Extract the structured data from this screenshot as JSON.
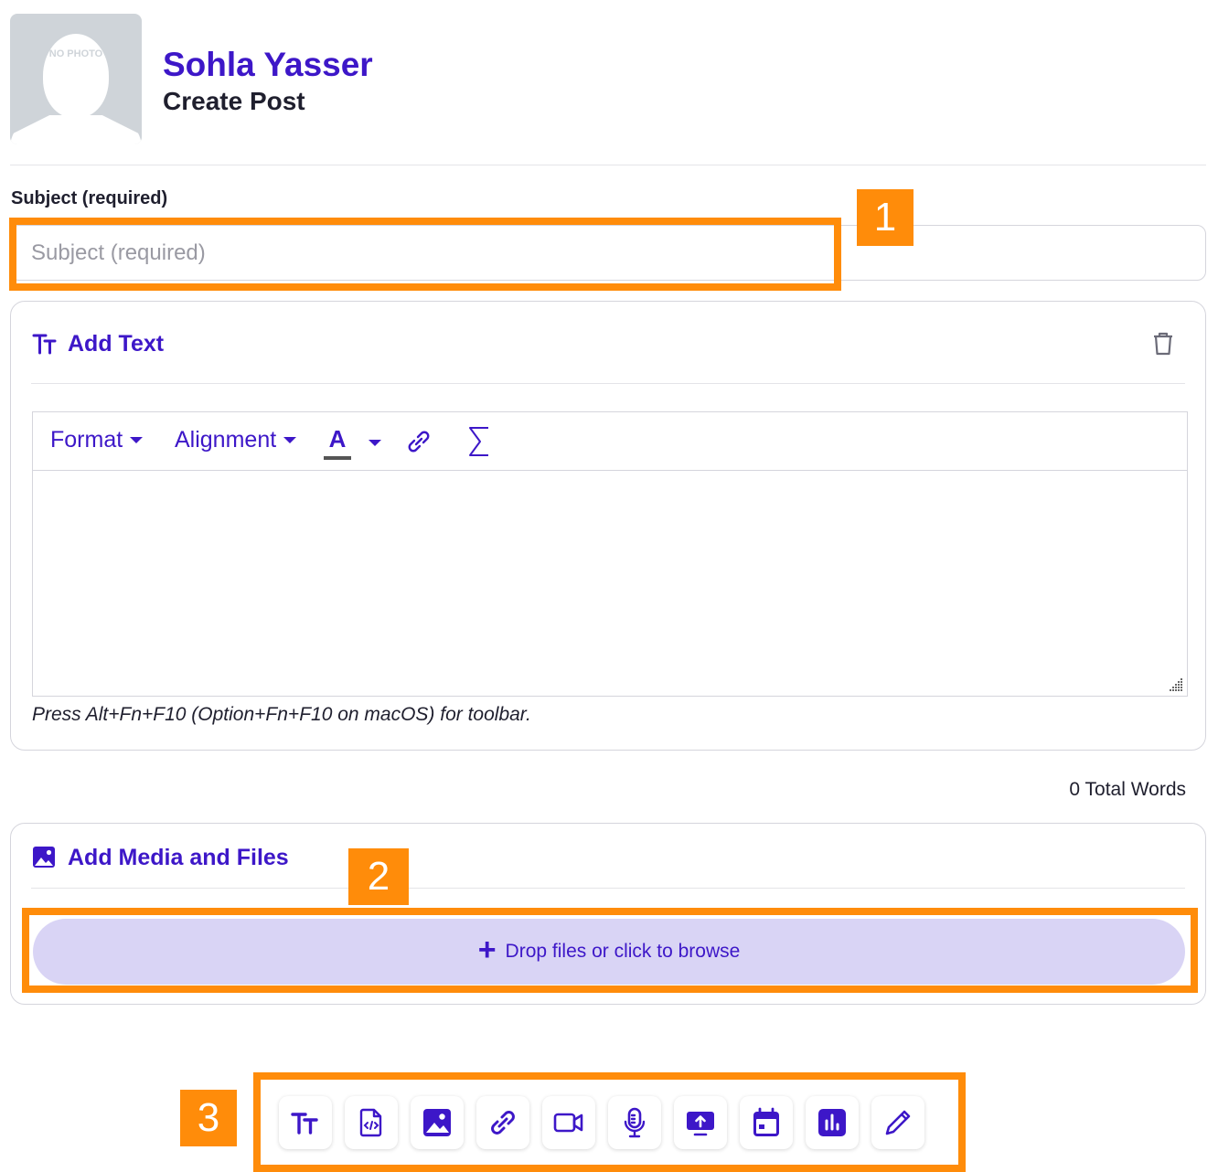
{
  "profile": {
    "avatar_text": "NO PHOTO",
    "name": "Sohla Yasser",
    "subtitle": "Create Post"
  },
  "subject": {
    "label": "Subject (required)",
    "placeholder": "Subject (required)",
    "value": ""
  },
  "text_block": {
    "title": "Add Text",
    "title_icon": "text-size-icon",
    "delete_icon": "trash-icon",
    "toolbar": {
      "format_label": "Format",
      "alignment_label": "Alignment",
      "font_color_label": "A",
      "link_icon": "link-icon",
      "equation_icon": "sigma-icon"
    },
    "content": "",
    "hint": "Press Alt+Fn+F10 (Option+Fn+F10 on macOS) for toolbar."
  },
  "word_count": "0 Total Words",
  "media_block": {
    "title": "Add Media and Files",
    "title_icon": "image-icon",
    "dropzone_plus": "+",
    "dropzone_label": "Drop files or click to browse"
  },
  "bottom_toolbar": [
    {
      "icon": "text-size-icon"
    },
    {
      "icon": "code-file-icon"
    },
    {
      "icon": "image-icon"
    },
    {
      "icon": "link-icon"
    },
    {
      "icon": "video-icon"
    },
    {
      "icon": "microphone-icon"
    },
    {
      "icon": "screen-share-icon"
    },
    {
      "icon": "calendar-icon"
    },
    {
      "icon": "poll-chart-icon"
    },
    {
      "icon": "pencil-icon"
    }
  ],
  "markers": [
    "1",
    "2",
    "3"
  ],
  "colors": {
    "accent": "#3d17c8",
    "dropzone": "#d9d4f5",
    "marker": "#ff8c0a",
    "border": "#d5d5dc"
  }
}
